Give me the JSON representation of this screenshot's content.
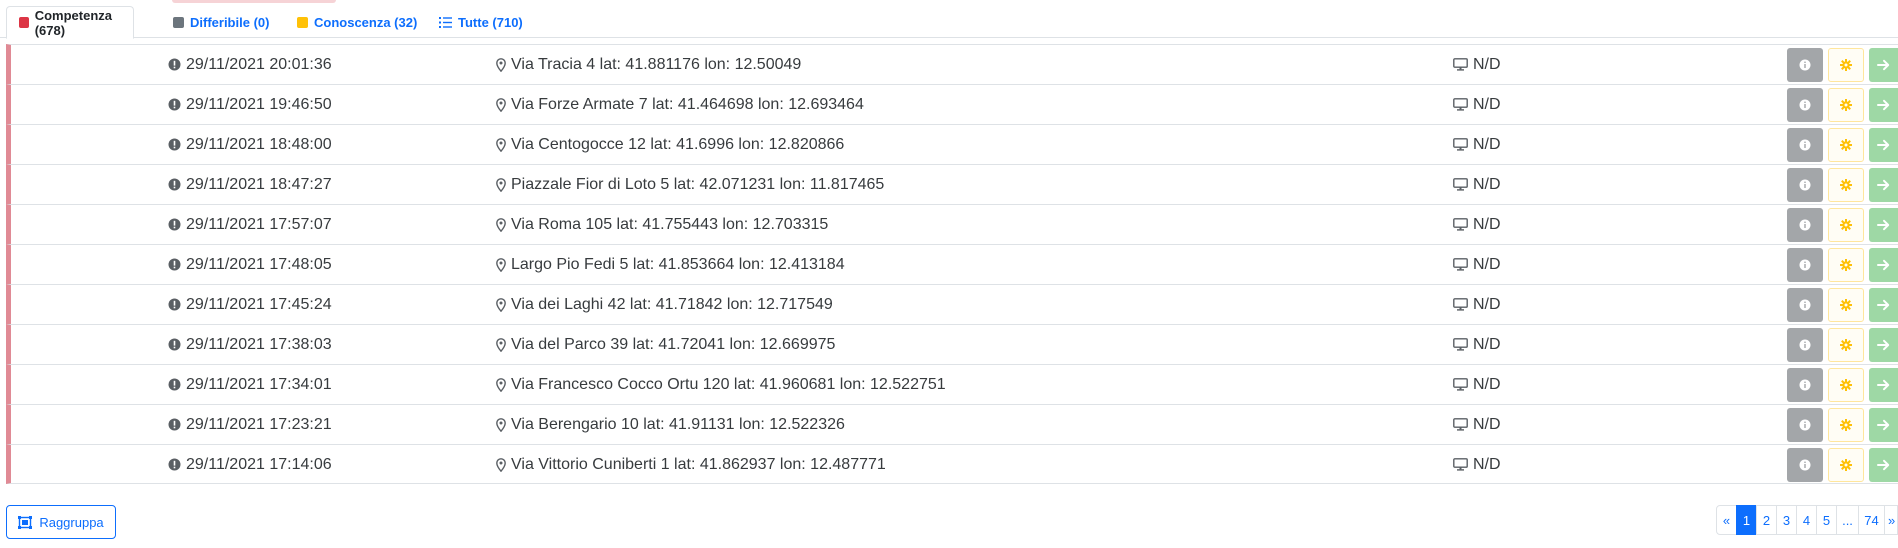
{
  "tabs": [
    {
      "label": "Competenza (678)",
      "color": "#dc3545"
    },
    {
      "label": "Differibile (0)",
      "color": "#6c757d"
    },
    {
      "label": "Conoscenza (32)",
      "color": "#ffc107"
    },
    {
      "label": "Tutte (710)",
      "color": "#0d6efd"
    }
  ],
  "rows": [
    {
      "time": "29/11/2021 20:01:36",
      "address": "Via Tracia 4 lat: 41.881176 lon: 12.50049",
      "device": "N/D"
    },
    {
      "time": "29/11/2021 19:46:50",
      "address": "Via Forze Armate 7 lat: 41.464698 lon: 12.693464",
      "device": "N/D"
    },
    {
      "time": "29/11/2021 18:48:00",
      "address": "Via Centogocce 12 lat: 41.6996 lon: 12.820866",
      "device": "N/D"
    },
    {
      "time": "29/11/2021 18:47:27",
      "address": "Piazzale Fior di Loto 5 lat: 42.071231 lon: 11.817465",
      "device": "N/D"
    },
    {
      "time": "29/11/2021 17:57:07",
      "address": "Via Roma 105 lat: 41.755443 lon: 12.703315",
      "device": "N/D"
    },
    {
      "time": "29/11/2021 17:48:05",
      "address": "Largo Pio Fedi 5 lat: 41.853664 lon: 12.413184",
      "device": "N/D"
    },
    {
      "time": "29/11/2021 17:45:24",
      "address": "Via dei Laghi 42 lat: 41.71842 lon: 12.717549",
      "device": "N/D"
    },
    {
      "time": "29/11/2021 17:38:03",
      "address": "Via del Parco 39 lat: 41.72041 lon: 12.669975",
      "device": "N/D"
    },
    {
      "time": "29/11/2021 17:34:01",
      "address": "Via Francesco Cocco Ortu 120 lat: 41.960681 lon: 12.522751",
      "device": "N/D"
    },
    {
      "time": "29/11/2021 17:23:21",
      "address": "Via Berengario 10 lat: 41.91131 lon: 12.522326",
      "device": "N/D"
    },
    {
      "time": "29/11/2021 17:14:06",
      "address": "Via Vittorio Cuniberti 1 lat: 41.862937 lon: 12.487771",
      "device": "N/D"
    }
  ],
  "row_icons": {
    "time": "exclamation-circle-icon",
    "address": "map-marker-icon",
    "device": "desktop-icon",
    "actions": [
      "info-icon",
      "gear-icon",
      "arrow-right-icon"
    ]
  },
  "colors": {
    "priority_bar": "#e08a95",
    "primary": "#0d6efd",
    "info_button": "#a3a6a9",
    "gear_button_border": "#ffe69c",
    "go_button": "#9ed8a5"
  },
  "group_button": {
    "label": "Raggruppa",
    "icon": "object-group-icon"
  },
  "pagination": {
    "prev": "«",
    "pages": [
      "1",
      "2",
      "3",
      "4",
      "5",
      "...",
      "74"
    ],
    "next": "»",
    "current": "1"
  }
}
